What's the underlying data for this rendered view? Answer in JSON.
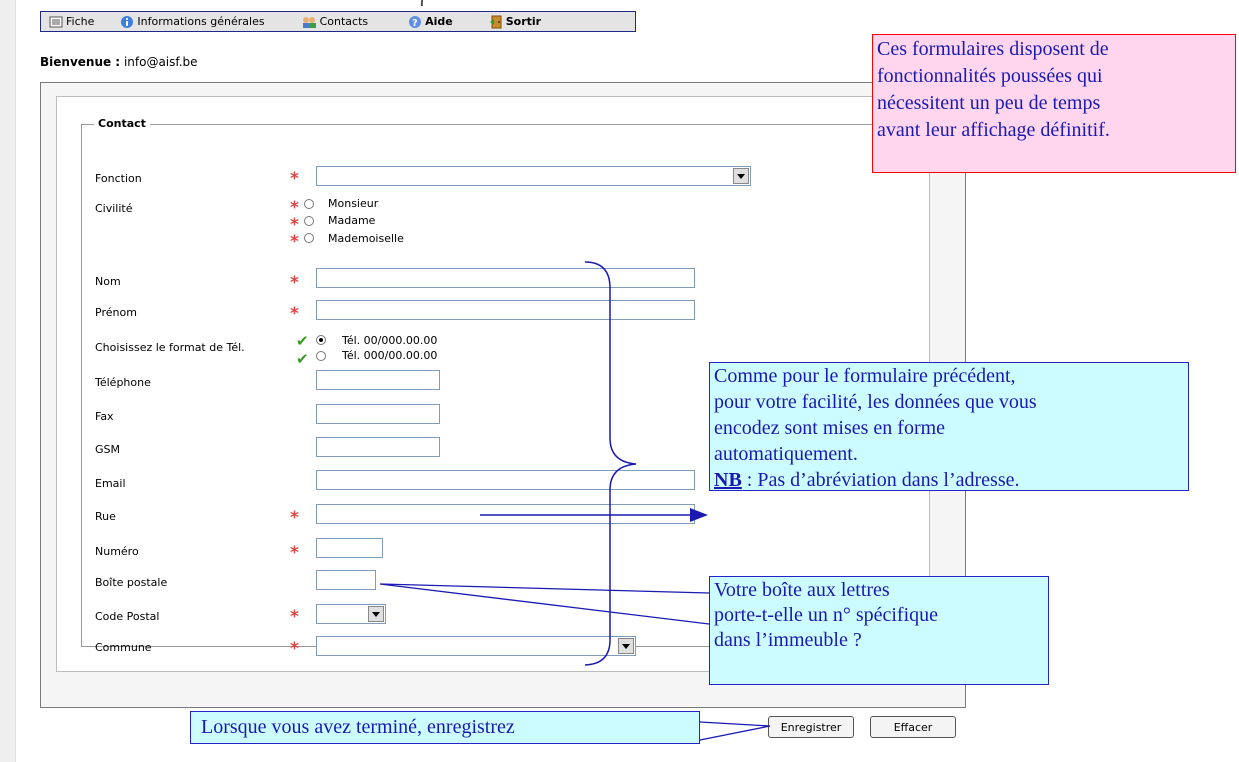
{
  "top_cut_text": "(",
  "menu": {
    "items": [
      {
        "label": "Fiche"
      },
      {
        "label": "Informations générales"
      },
      {
        "label": "Contacts"
      },
      {
        "label": "Aide"
      },
      {
        "label": "Sortir"
      }
    ]
  },
  "welcome": {
    "prefix": "Bienvenue :",
    "email": "info@aisf.be"
  },
  "form": {
    "legend": "Contact",
    "fonction_label": "Fonction",
    "civilite_label": "Civilité",
    "civilite_options": [
      "Monsieur",
      "Madame",
      "Mademoiselle"
    ],
    "nom_label": "Nom",
    "prenom_label": "Prénom",
    "tel_format_label": "Choisissez le format de Tél.",
    "tel_format_options": [
      "Tél. 00/000.00.00",
      "Tél. 000/00.00.00"
    ],
    "telephone_label": "Téléphone",
    "fax_label": "Fax",
    "gsm_label": "GSM",
    "email_label": "Email",
    "rue_label": "Rue",
    "numero_label": "Numéro",
    "boite_label": "Boîte postale",
    "code_postal_label": "Code Postal",
    "commune_label": "Commune"
  },
  "buttons": {
    "save": "Enregistrer",
    "clear": "Effacer"
  },
  "callouts": {
    "pink_lines": [
      "Ces formulaires disposent de",
      "fonctionnalités  poussées qui",
      "nécessitent un peu de temps",
      "avant leur affichage définitif."
    ],
    "blue1_lines": [
      "Comme pour le formulaire précédent,",
      "pour votre facilité, les données que vous",
      "encodez sont mises en forme",
      "automatiquement."
    ],
    "blue1_nb": "NB",
    "blue1_nb_text": " :  Pas d’abréviation dans l’adresse.",
    "blue2_lines": [
      "Votre boîte aux lettres",
      "porte-t-elle un n° spécifique",
      "dans l’immeuble ?"
    ],
    "blue3": "Lorsque vous avez terminé, enregistrez"
  },
  "colors": {
    "accent_red": "#e04545",
    "callout_blue_bg": "#ccfcff",
    "callout_pink_bg": "#ffd6ee",
    "check_green": "#3a9b1e"
  }
}
